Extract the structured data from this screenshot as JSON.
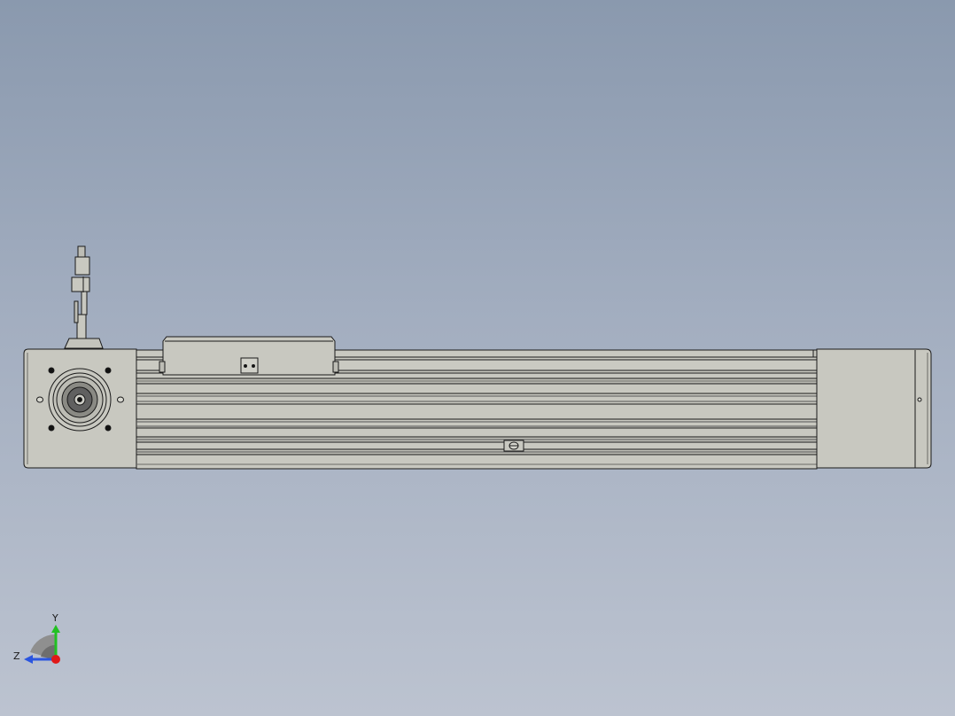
{
  "view": {
    "background_top": "#8a99ae",
    "background_bottom": "#bcc3d0",
    "part_fill": "#c8c8c0",
    "edge_color": "#1a1a1a"
  },
  "triad": {
    "y_label": "Y",
    "z_label": "Z",
    "y_color": "#22c022",
    "z_color": "#2a55e0",
    "x_color": "#e01818"
  }
}
